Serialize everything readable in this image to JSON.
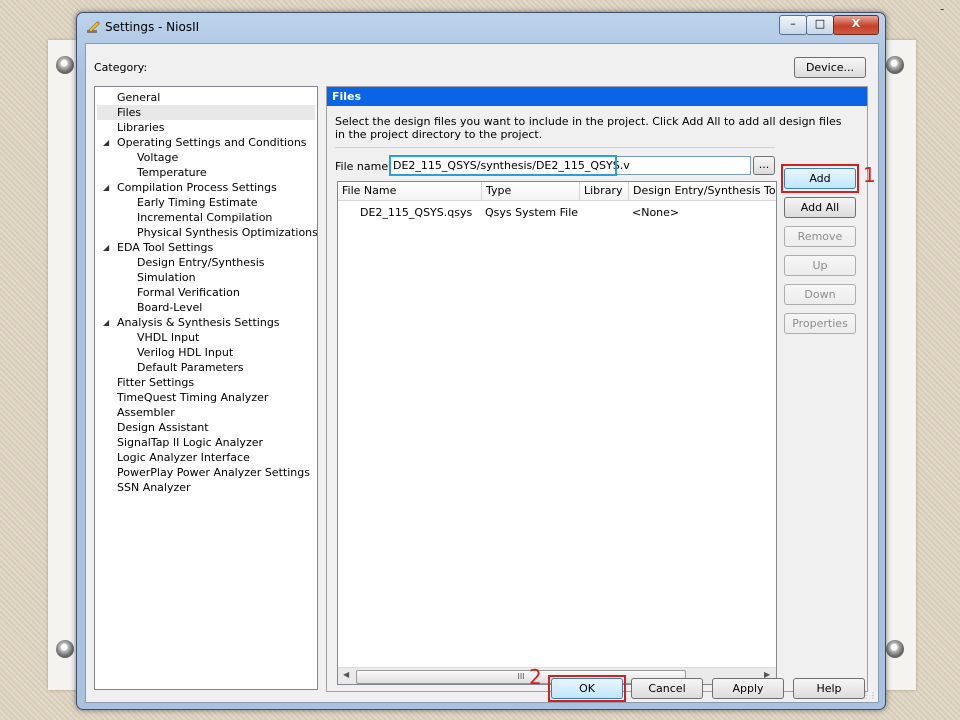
{
  "window": {
    "title": "Settings - NiosII",
    "minimize_label": "–",
    "maximize_label": "□",
    "close_label": "X"
  },
  "category_label": "Category:",
  "device_button": "Device...",
  "tree": [
    {
      "label": "General",
      "level": 0
    },
    {
      "label": "Files",
      "level": 0,
      "selected": true
    },
    {
      "label": "Libraries",
      "level": 0
    },
    {
      "label": "Operating Settings and Conditions",
      "level": 0,
      "expanded": true
    },
    {
      "label": "Voltage",
      "level": 1
    },
    {
      "label": "Temperature",
      "level": 1
    },
    {
      "label": "Compilation Process Settings",
      "level": 0,
      "expanded": true
    },
    {
      "label": "Early Timing Estimate",
      "level": 1
    },
    {
      "label": "Incremental Compilation",
      "level": 1
    },
    {
      "label": "Physical Synthesis Optimizations",
      "level": 1
    },
    {
      "label": "EDA Tool Settings",
      "level": 0,
      "expanded": true
    },
    {
      "label": "Design Entry/Synthesis",
      "level": 1
    },
    {
      "label": "Simulation",
      "level": 1
    },
    {
      "label": "Formal Verification",
      "level": 1
    },
    {
      "label": "Board-Level",
      "level": 1
    },
    {
      "label": "Analysis & Synthesis Settings",
      "level": 0,
      "expanded": true
    },
    {
      "label": "VHDL Input",
      "level": 1
    },
    {
      "label": "Verilog HDL Input",
      "level": 1
    },
    {
      "label": "Default Parameters",
      "level": 1
    },
    {
      "label": "Fitter Settings",
      "level": 0
    },
    {
      "label": "TimeQuest Timing Analyzer",
      "level": 0
    },
    {
      "label": "Assembler",
      "level": 0
    },
    {
      "label": "Design Assistant",
      "level": 0
    },
    {
      "label": "SignalTap II Logic Analyzer",
      "level": 0
    },
    {
      "label": "Logic Analyzer Interface",
      "level": 0
    },
    {
      "label": "PowerPlay Power Analyzer Settings",
      "level": 0
    },
    {
      "label": "SSN Analyzer",
      "level": 0
    }
  ],
  "panel": {
    "header": "Files",
    "description": "Select the design files you want to include in the project. Click Add All to add all design files in the project directory to the project.",
    "file_name_label": "File name:",
    "file_name_value": "DE2_115_QSYS/synthesis/DE2_115_QSYS.v",
    "browse_label": "...",
    "columns": [
      "File Name",
      "Type",
      "Library",
      "Design Entry/Synthesis Tool"
    ],
    "rows": [
      {
        "file_name": "DE2_115_QSYS.qsys",
        "type": "Qsys System File",
        "library": "",
        "tool": "<None>"
      }
    ],
    "scroll_thumb": "III"
  },
  "side_buttons": {
    "add": "Add",
    "add_all": "Add All",
    "remove": "Remove",
    "up": "Up",
    "down": "Down",
    "properties": "Properties"
  },
  "bottom_buttons": {
    "ok": "OK",
    "cancel": "Cancel",
    "apply": "Apply",
    "help": "Help"
  },
  "annotations": {
    "add_marker": "1",
    "ok_marker": "2",
    "highlight_color": "#d42020",
    "file_highlight_color": "#27a0dc"
  },
  "slide_mark": "-"
}
